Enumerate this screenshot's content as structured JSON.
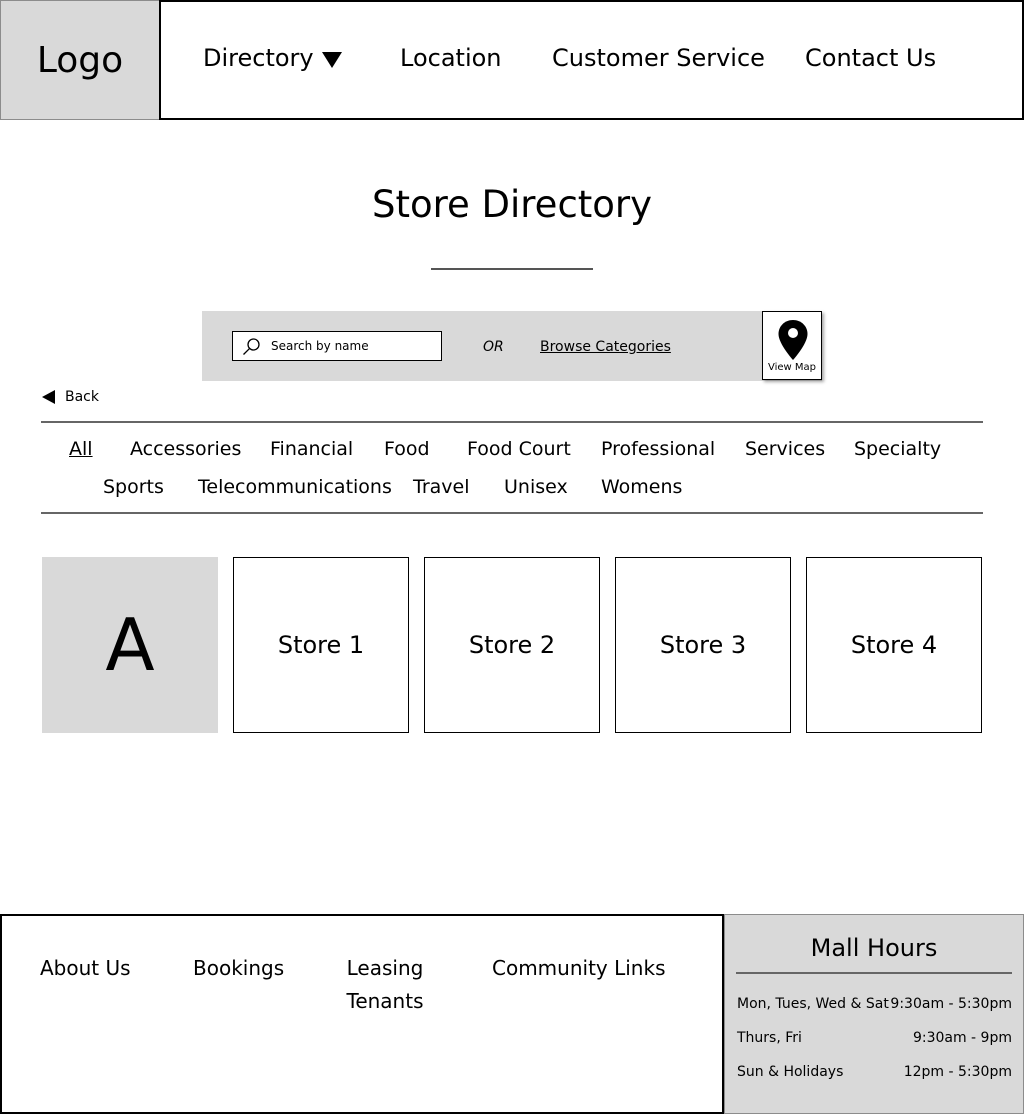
{
  "header": {
    "logo": "Logo",
    "nav": {
      "directory": "Directory",
      "location": "Location",
      "customer_service": "Customer Service",
      "contact_us": "Contact Us"
    }
  },
  "main": {
    "title": "Store Directory",
    "search": {
      "placeholder": "Search by name",
      "value": "",
      "or_text": "OR",
      "browse_label": "Browse Categories",
      "view_map_label": "View Map"
    },
    "back_label": "Back",
    "categories": [
      "All",
      "Accessories",
      "Financial",
      "Food",
      "Food Court",
      "Professional",
      "Services",
      "Specialty",
      "Sports",
      "Telecommunications",
      "Travel",
      "Unisex",
      "Womens"
    ],
    "selected_category": "All",
    "tiles": {
      "letter": "A",
      "stores": [
        "Store 1",
        "Store 2",
        "Store 3",
        "Store 4"
      ]
    }
  },
  "footer": {
    "links": {
      "about": "About Us",
      "bookings": "Bookings",
      "leasing_line1": "Leasing",
      "leasing_line2": "Tenants",
      "community": "Community Links"
    },
    "hours": {
      "title": "Mall Hours",
      "rows": [
        {
          "days": "Mon, Tues, Wed & Sat",
          "time": "9:30am - 5:30pm"
        },
        {
          "days": "Thurs, Fri",
          "time": "9:30am - 9pm"
        },
        {
          "days": "Sun & Holidays",
          "time": "12pm - 5:30pm"
        }
      ]
    }
  },
  "icons": {
    "nav_caret": "triangle-down",
    "search": "magnifier",
    "map": "map-pin",
    "back": "triangle-left"
  }
}
